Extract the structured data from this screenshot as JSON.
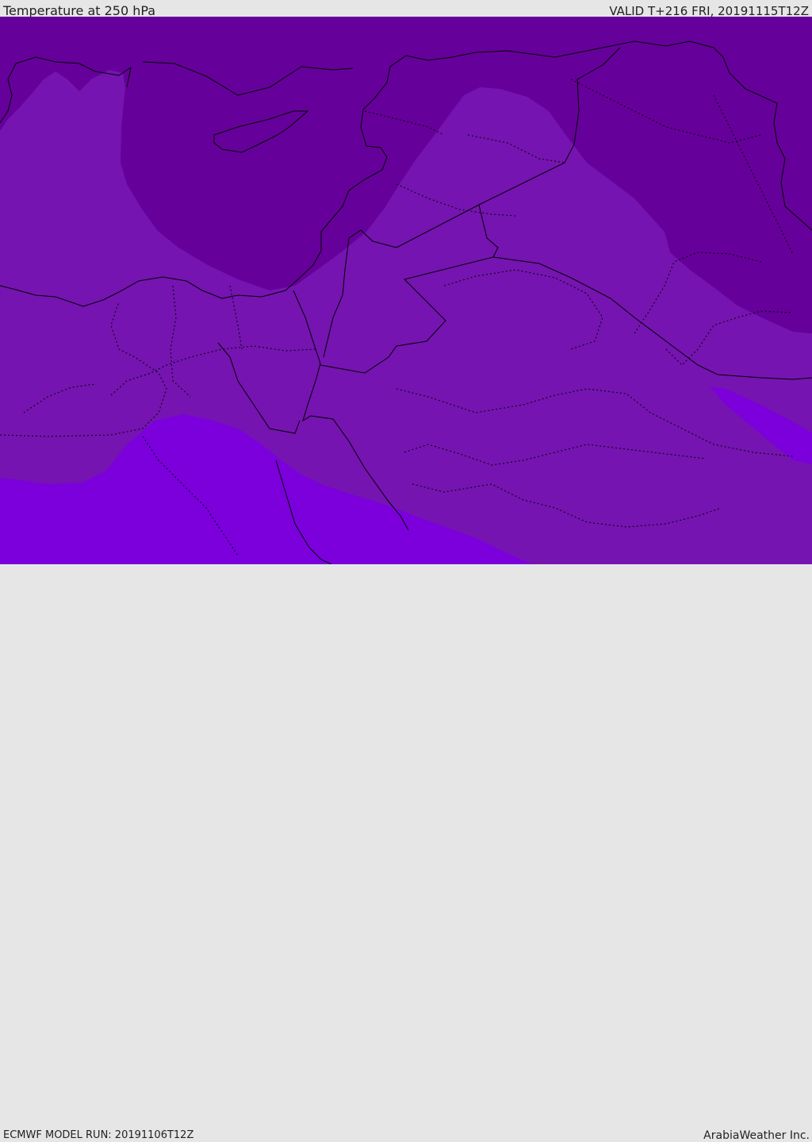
{
  "header": {
    "title": "Temperature at 250 hPa",
    "valid": "VALID T+216 FRI, 20191115T12Z"
  },
  "footer": {
    "model_run": "ECMWF MODEL RUN: 20191106T12Z",
    "brand": "ArabiaWeather Inc."
  },
  "colors": {
    "cold_deep": "#66009a",
    "cold_mid": "#7514b0",
    "warm": "#7b00dc",
    "border_line": "#000000",
    "background": "#e6e6e6"
  }
}
